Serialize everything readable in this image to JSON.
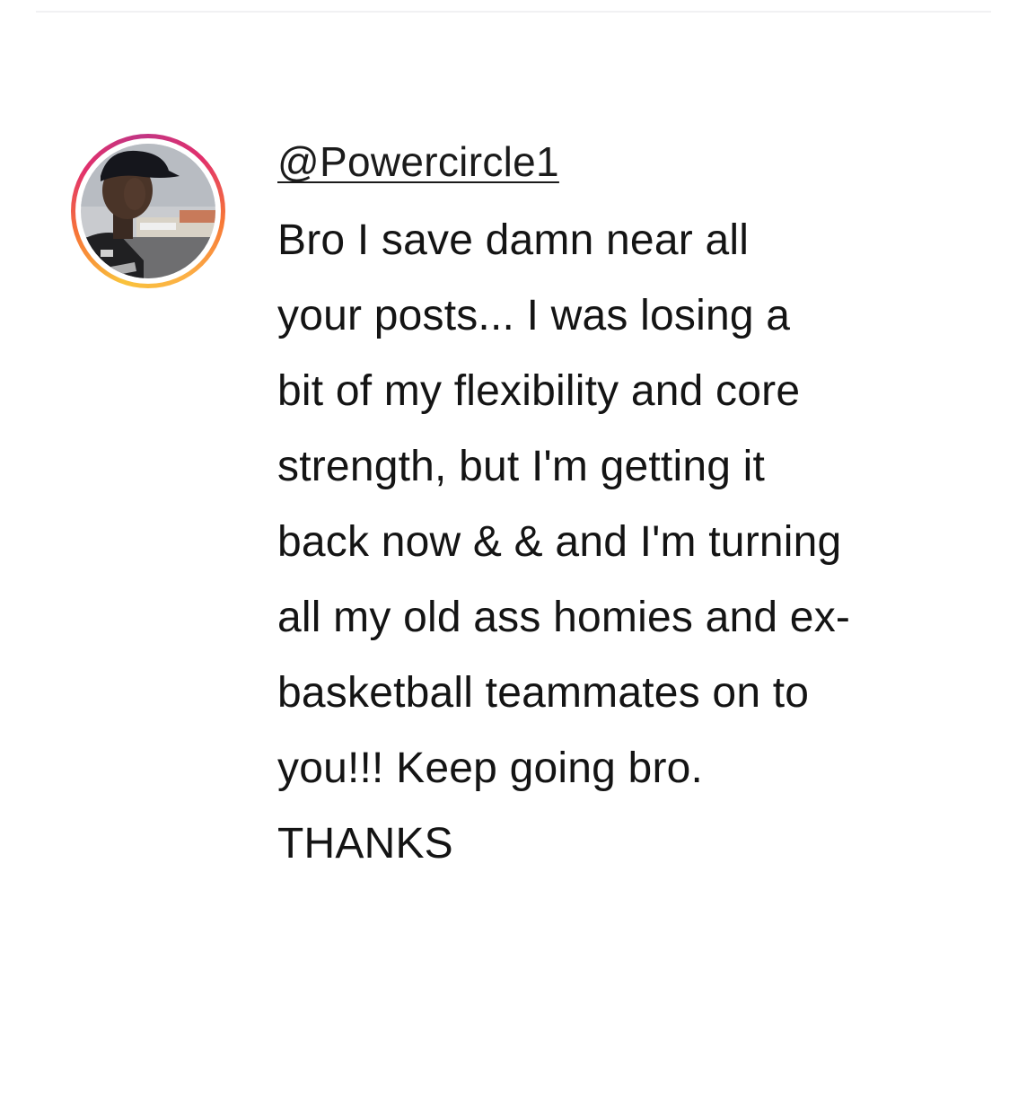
{
  "comment": {
    "avatar_icon": "user-avatar-photo",
    "username": "@Powercircle1",
    "lines": [
      "Bro I save damn near all",
      "your posts... I was losing a",
      "bit of my flexibility and core",
      "strength, but I'm getting it",
      "back now & & and I'm turning",
      "all my old ass homies and ex-",
      "basketball teammates on to",
      "you!!! Keep going bro.",
      "THANKS"
    ]
  },
  "colors": {
    "ring_gradient": [
      "#f9c23c",
      "#f77737",
      "#e1306c",
      "#c13584"
    ],
    "text": "#141414",
    "background": "#ffffff"
  }
}
